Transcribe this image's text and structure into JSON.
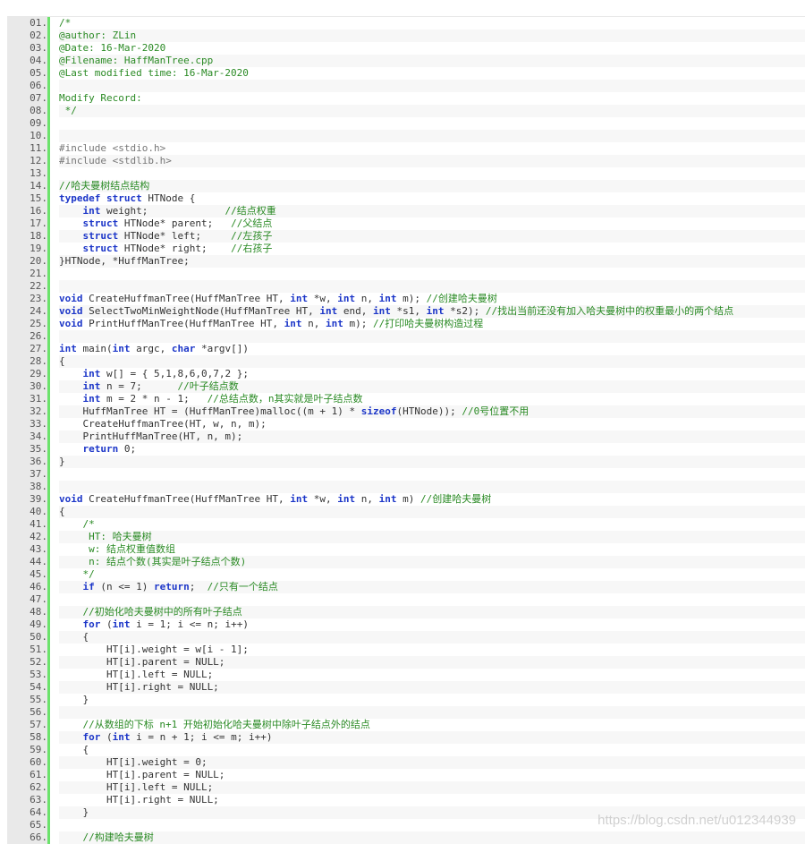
{
  "watermark": "https://blog.csdn.net/u012344939",
  "lines": [
    {
      "n": "01.",
      "segs": [
        {
          "t": "/*",
          "c": "cm"
        }
      ]
    },
    {
      "n": "02.",
      "segs": [
        {
          "t": "@author: ZLin",
          "c": "cm"
        }
      ]
    },
    {
      "n": "03.",
      "segs": [
        {
          "t": "@Date: 16-Mar-2020",
          "c": "cm"
        }
      ]
    },
    {
      "n": "04.",
      "segs": [
        {
          "t": "@Filename: HaffManTree.cpp",
          "c": "cm"
        }
      ]
    },
    {
      "n": "05.",
      "segs": [
        {
          "t": "@Last modified time: 16-Mar-2020",
          "c": "cm"
        }
      ]
    },
    {
      "n": "06.",
      "segs": []
    },
    {
      "n": "07.",
      "segs": [
        {
          "t": "Modify Record:",
          "c": "cm"
        }
      ]
    },
    {
      "n": "08.",
      "segs": [
        {
          "t": " */",
          "c": "cm"
        }
      ]
    },
    {
      "n": "09.",
      "segs": []
    },
    {
      "n": "10.",
      "segs": []
    },
    {
      "n": "11.",
      "segs": [
        {
          "t": "#include <stdio.h>",
          "c": "pp"
        }
      ]
    },
    {
      "n": "12.",
      "segs": [
        {
          "t": "#include <stdlib.h>",
          "c": "pp"
        }
      ]
    },
    {
      "n": "13.",
      "segs": []
    },
    {
      "n": "14.",
      "segs": [
        {
          "t": "//哈夫曼树结点结构",
          "c": "cm"
        }
      ]
    },
    {
      "n": "15.",
      "segs": [
        {
          "t": "typedef struct",
          "c": "kw"
        },
        {
          "t": " HTNode {"
        }
      ]
    },
    {
      "n": "16.",
      "segs": [
        {
          "t": "    "
        },
        {
          "t": "int",
          "c": "kw"
        },
        {
          "t": " weight;             "
        },
        {
          "t": "//结点权重",
          "c": "cm"
        }
      ]
    },
    {
      "n": "17.",
      "segs": [
        {
          "t": "    "
        },
        {
          "t": "struct",
          "c": "kw"
        },
        {
          "t": " HTNode* parent;   "
        },
        {
          "t": "//父结点",
          "c": "cm"
        }
      ]
    },
    {
      "n": "18.",
      "segs": [
        {
          "t": "    "
        },
        {
          "t": "struct",
          "c": "kw"
        },
        {
          "t": " HTNode* left;     "
        },
        {
          "t": "//左孩子",
          "c": "cm"
        }
      ]
    },
    {
      "n": "19.",
      "segs": [
        {
          "t": "    "
        },
        {
          "t": "struct",
          "c": "kw"
        },
        {
          "t": " HTNode* right;    "
        },
        {
          "t": "//右孩子",
          "c": "cm"
        }
      ]
    },
    {
      "n": "20.",
      "segs": [
        {
          "t": "}HTNode, *HuffManTree;"
        }
      ]
    },
    {
      "n": "21.",
      "segs": []
    },
    {
      "n": "22.",
      "segs": []
    },
    {
      "n": "23.",
      "segs": [
        {
          "t": "void",
          "c": "kw"
        },
        {
          "t": " CreateHuffmanTree(HuffManTree HT, "
        },
        {
          "t": "int",
          "c": "kw"
        },
        {
          "t": " *w, "
        },
        {
          "t": "int",
          "c": "kw"
        },
        {
          "t": " n, "
        },
        {
          "t": "int",
          "c": "kw"
        },
        {
          "t": " m); "
        },
        {
          "t": "//创建哈夫曼树",
          "c": "cm"
        }
      ]
    },
    {
      "n": "24.",
      "segs": [
        {
          "t": "void",
          "c": "kw"
        },
        {
          "t": " SelectTwoMinWeightNode(HuffManTree HT, "
        },
        {
          "t": "int",
          "c": "kw"
        },
        {
          "t": " end, "
        },
        {
          "t": "int",
          "c": "kw"
        },
        {
          "t": " *s1, "
        },
        {
          "t": "int",
          "c": "kw"
        },
        {
          "t": " *s2); "
        },
        {
          "t": "//找出当前还没有加入哈夫曼树中的权重最小的两个结点",
          "c": "cm"
        }
      ]
    },
    {
      "n": "25.",
      "segs": [
        {
          "t": "void",
          "c": "kw"
        },
        {
          "t": " PrintHuffManTree(HuffManTree HT, "
        },
        {
          "t": "int",
          "c": "kw"
        },
        {
          "t": " n, "
        },
        {
          "t": "int",
          "c": "kw"
        },
        {
          "t": " m); "
        },
        {
          "t": "//打印哈夫曼树构造过程",
          "c": "cm"
        }
      ]
    },
    {
      "n": "26.",
      "segs": []
    },
    {
      "n": "27.",
      "segs": [
        {
          "t": "int",
          "c": "kw"
        },
        {
          "t": " main("
        },
        {
          "t": "int",
          "c": "kw"
        },
        {
          "t": " argc, "
        },
        {
          "t": "char",
          "c": "kw"
        },
        {
          "t": " *argv[])"
        }
      ]
    },
    {
      "n": "28.",
      "segs": [
        {
          "t": "{"
        }
      ]
    },
    {
      "n": "29.",
      "segs": [
        {
          "t": "    "
        },
        {
          "t": "int",
          "c": "kw"
        },
        {
          "t": " w[] = { 5,1,8,6,0,7,2 };"
        }
      ]
    },
    {
      "n": "30.",
      "segs": [
        {
          "t": "    "
        },
        {
          "t": "int",
          "c": "kw"
        },
        {
          "t": " n = 7;      "
        },
        {
          "t": "//叶子结点数",
          "c": "cm"
        }
      ]
    },
    {
      "n": "31.",
      "segs": [
        {
          "t": "    "
        },
        {
          "t": "int",
          "c": "kw"
        },
        {
          "t": " m = 2 * n - 1;   "
        },
        {
          "t": "//总结点数，n其实就是叶子结点数",
          "c": "cm"
        }
      ]
    },
    {
      "n": "32.",
      "segs": [
        {
          "t": "    HuffManTree HT = (HuffManTree)malloc((m + 1) * "
        },
        {
          "t": "sizeof",
          "c": "kw"
        },
        {
          "t": "(HTNode)); "
        },
        {
          "t": "//0号位置不用",
          "c": "cm"
        }
      ]
    },
    {
      "n": "33.",
      "segs": [
        {
          "t": "    CreateHuffmanTree(HT, w, n, m);"
        }
      ]
    },
    {
      "n": "34.",
      "segs": [
        {
          "t": "    PrintHuffManTree(HT, n, m);"
        }
      ]
    },
    {
      "n": "35.",
      "segs": [
        {
          "t": "    "
        },
        {
          "t": "return",
          "c": "kw"
        },
        {
          "t": " 0;"
        }
      ]
    },
    {
      "n": "36.",
      "segs": [
        {
          "t": "}"
        }
      ]
    },
    {
      "n": "37.",
      "segs": []
    },
    {
      "n": "38.",
      "segs": []
    },
    {
      "n": "39.",
      "segs": [
        {
          "t": "void",
          "c": "kw"
        },
        {
          "t": " CreateHuffmanTree(HuffManTree HT, "
        },
        {
          "t": "int",
          "c": "kw"
        },
        {
          "t": " *w, "
        },
        {
          "t": "int",
          "c": "kw"
        },
        {
          "t": " n, "
        },
        {
          "t": "int",
          "c": "kw"
        },
        {
          "t": " m) "
        },
        {
          "t": "//创建哈夫曼树",
          "c": "cm"
        }
      ]
    },
    {
      "n": "40.",
      "segs": [
        {
          "t": "{"
        }
      ]
    },
    {
      "n": "41.",
      "segs": [
        {
          "t": "    "
        },
        {
          "t": "/*",
          "c": "cm"
        }
      ]
    },
    {
      "n": "42.",
      "segs": [
        {
          "t": "     HT: 哈夫曼树",
          "c": "cm"
        }
      ]
    },
    {
      "n": "43.",
      "segs": [
        {
          "t": "     w: 结点权重值数组",
          "c": "cm"
        }
      ]
    },
    {
      "n": "44.",
      "segs": [
        {
          "t": "     n: 结点个数(其实是叶子结点个数)",
          "c": "cm"
        }
      ]
    },
    {
      "n": "45.",
      "segs": [
        {
          "t": "    */",
          "c": "cm"
        }
      ]
    },
    {
      "n": "46.",
      "segs": [
        {
          "t": "    "
        },
        {
          "t": "if",
          "c": "kw"
        },
        {
          "t": " (n <= 1) "
        },
        {
          "t": "return",
          "c": "kw"
        },
        {
          "t": ";  "
        },
        {
          "t": "//只有一个结点",
          "c": "cm"
        }
      ]
    },
    {
      "n": "47.",
      "segs": []
    },
    {
      "n": "48.",
      "segs": [
        {
          "t": "    "
        },
        {
          "t": "//初始化哈夫曼树中的所有叶子结点",
          "c": "cm"
        }
      ]
    },
    {
      "n": "49.",
      "segs": [
        {
          "t": "    "
        },
        {
          "t": "for",
          "c": "kw"
        },
        {
          "t": " ("
        },
        {
          "t": "int",
          "c": "kw"
        },
        {
          "t": " i = 1; i <= n; i++)"
        }
      ]
    },
    {
      "n": "50.",
      "segs": [
        {
          "t": "    {"
        }
      ]
    },
    {
      "n": "51.",
      "segs": [
        {
          "t": "        HT[i].weight = w[i - 1];"
        }
      ]
    },
    {
      "n": "52.",
      "segs": [
        {
          "t": "        HT[i].parent = NULL;"
        }
      ]
    },
    {
      "n": "53.",
      "segs": [
        {
          "t": "        HT[i].left = NULL;"
        }
      ]
    },
    {
      "n": "54.",
      "segs": [
        {
          "t": "        HT[i].right = NULL;"
        }
      ]
    },
    {
      "n": "55.",
      "segs": [
        {
          "t": "    }"
        }
      ]
    },
    {
      "n": "56.",
      "segs": []
    },
    {
      "n": "57.",
      "segs": [
        {
          "t": "    "
        },
        {
          "t": "//从数组的下标 n+1 开始初始化哈夫曼树中除叶子结点外的结点",
          "c": "cm"
        }
      ]
    },
    {
      "n": "58.",
      "segs": [
        {
          "t": "    "
        },
        {
          "t": "for",
          "c": "kw"
        },
        {
          "t": " ("
        },
        {
          "t": "int",
          "c": "kw"
        },
        {
          "t": " i = n + 1; i <= m; i++)"
        }
      ]
    },
    {
      "n": "59.",
      "segs": [
        {
          "t": "    {"
        }
      ]
    },
    {
      "n": "60.",
      "segs": [
        {
          "t": "        HT[i].weight = 0;"
        }
      ]
    },
    {
      "n": "61.",
      "segs": [
        {
          "t": "        HT[i].parent = NULL;"
        }
      ]
    },
    {
      "n": "62.",
      "segs": [
        {
          "t": "        HT[i].left = NULL;"
        }
      ]
    },
    {
      "n": "63.",
      "segs": [
        {
          "t": "        HT[i].right = NULL;"
        }
      ]
    },
    {
      "n": "64.",
      "segs": [
        {
          "t": "    }"
        }
      ]
    },
    {
      "n": "65.",
      "segs": []
    },
    {
      "n": "66.",
      "segs": [
        {
          "t": "    "
        },
        {
          "t": "//构建哈夫曼树",
          "c": "cm"
        }
      ]
    }
  ]
}
